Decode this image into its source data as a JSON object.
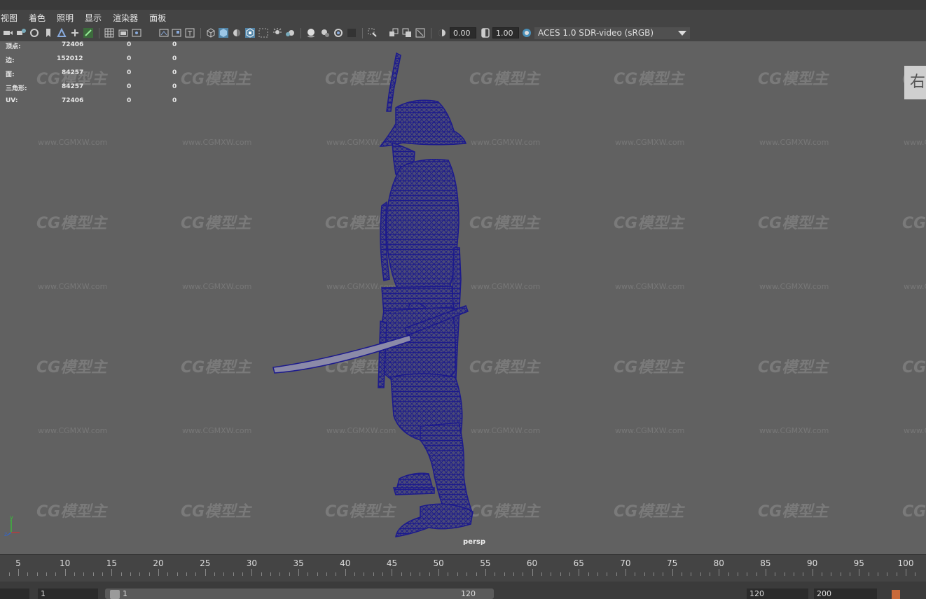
{
  "menu": [
    "视图",
    "着色",
    "照明",
    "显示",
    "渲染器",
    "面板"
  ],
  "toolbar": {
    "icons": [
      "camera-select-icon",
      "camera-attributes-icon",
      "bookmark-icon",
      "image-plane-icon",
      "grid-icon",
      "film-gate-icon",
      "resolution-gate-icon",
      "gate-mask-icon",
      "field-chart-icon",
      "safe-action-icon",
      "safe-title-icon",
      "wireframe-icon",
      "smooth-shade-icon",
      "default-material-icon",
      "textured-icon",
      "use-lights-icon",
      "shadows-icon",
      "ambient-occlusion-icon",
      "motion-blur-icon",
      "anti-aliasing-icon",
      "depth-of-field-icon",
      "isolate-select-icon",
      "xray-icon",
      "xray-joints-icon",
      "backface-cull-icon",
      "exposure-icon",
      "gamma-icon",
      "color-management-icon"
    ],
    "exposure_value": "0.00",
    "gamma_value": "1.00",
    "color_space": "ACES 1.0 SDR-video (sRGB)"
  },
  "hud": [
    {
      "label": "顶点:",
      "total": "72406",
      "selected": "0",
      "region": "0"
    },
    {
      "label": "边:",
      "total": "152012",
      "selected": "0",
      "region": "0"
    },
    {
      "label": "面:",
      "total": "84257",
      "selected": "0",
      "region": "0"
    },
    {
      "label": "三角形:",
      "total": "84257",
      "selected": "0",
      "region": "0"
    },
    {
      "label": "UV:",
      "total": "72406",
      "selected": "0",
      "region": "0"
    }
  ],
  "viewport": {
    "camera_label": "persp",
    "viewcube_label": "右",
    "axis_y": "y",
    "axis_z": "z",
    "watermark_logo": "CG模型主",
    "watermark_url": "www.CGMXW.com",
    "wire_color": "#1c1a8c",
    "background_color": "#616161"
  },
  "timeline": {
    "ticks": [
      "5",
      "10",
      "15",
      "20",
      "25",
      "30",
      "35",
      "40",
      "45",
      "50",
      "55",
      "60",
      "65",
      "70",
      "75",
      "80",
      "85",
      "90",
      "95",
      "100"
    ]
  },
  "range": {
    "start": "1",
    "slider_start": "1",
    "slider_end": "120",
    "end": "120",
    "anim_end": "200"
  }
}
